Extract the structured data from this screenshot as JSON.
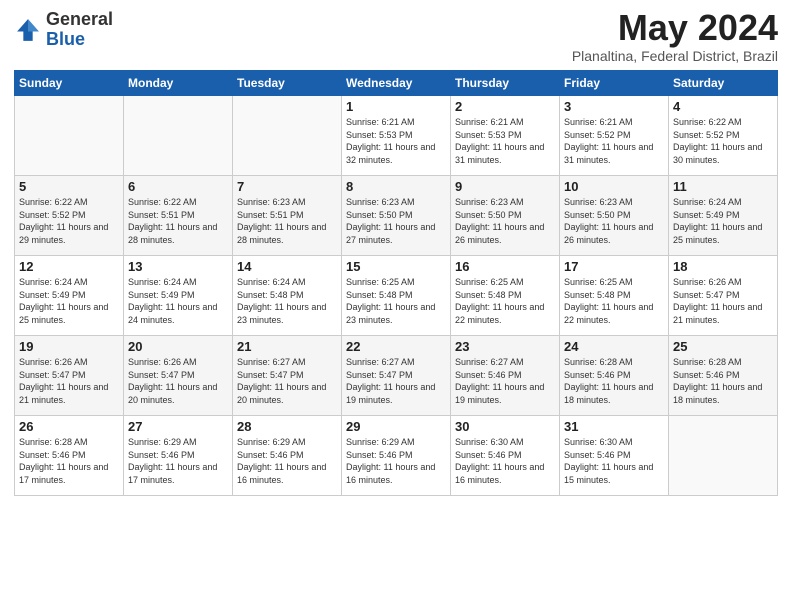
{
  "logo": {
    "general": "General",
    "blue": "Blue"
  },
  "title": "May 2024",
  "location": "Planaltina, Federal District, Brazil",
  "days_of_week": [
    "Sunday",
    "Monday",
    "Tuesday",
    "Wednesday",
    "Thursday",
    "Friday",
    "Saturday"
  ],
  "weeks": [
    [
      {
        "day": "",
        "content": ""
      },
      {
        "day": "",
        "content": ""
      },
      {
        "day": "",
        "content": ""
      },
      {
        "day": "1",
        "content": "Sunrise: 6:21 AM\nSunset: 5:53 PM\nDaylight: 11 hours and 32 minutes."
      },
      {
        "day": "2",
        "content": "Sunrise: 6:21 AM\nSunset: 5:53 PM\nDaylight: 11 hours and 31 minutes."
      },
      {
        "day": "3",
        "content": "Sunrise: 6:21 AM\nSunset: 5:52 PM\nDaylight: 11 hours and 31 minutes."
      },
      {
        "day": "4",
        "content": "Sunrise: 6:22 AM\nSunset: 5:52 PM\nDaylight: 11 hours and 30 minutes."
      }
    ],
    [
      {
        "day": "5",
        "content": "Sunrise: 6:22 AM\nSunset: 5:52 PM\nDaylight: 11 hours and 29 minutes."
      },
      {
        "day": "6",
        "content": "Sunrise: 6:22 AM\nSunset: 5:51 PM\nDaylight: 11 hours and 28 minutes."
      },
      {
        "day": "7",
        "content": "Sunrise: 6:23 AM\nSunset: 5:51 PM\nDaylight: 11 hours and 28 minutes."
      },
      {
        "day": "8",
        "content": "Sunrise: 6:23 AM\nSunset: 5:50 PM\nDaylight: 11 hours and 27 minutes."
      },
      {
        "day": "9",
        "content": "Sunrise: 6:23 AM\nSunset: 5:50 PM\nDaylight: 11 hours and 26 minutes."
      },
      {
        "day": "10",
        "content": "Sunrise: 6:23 AM\nSunset: 5:50 PM\nDaylight: 11 hours and 26 minutes."
      },
      {
        "day": "11",
        "content": "Sunrise: 6:24 AM\nSunset: 5:49 PM\nDaylight: 11 hours and 25 minutes."
      }
    ],
    [
      {
        "day": "12",
        "content": "Sunrise: 6:24 AM\nSunset: 5:49 PM\nDaylight: 11 hours and 25 minutes."
      },
      {
        "day": "13",
        "content": "Sunrise: 6:24 AM\nSunset: 5:49 PM\nDaylight: 11 hours and 24 minutes."
      },
      {
        "day": "14",
        "content": "Sunrise: 6:24 AM\nSunset: 5:48 PM\nDaylight: 11 hours and 23 minutes."
      },
      {
        "day": "15",
        "content": "Sunrise: 6:25 AM\nSunset: 5:48 PM\nDaylight: 11 hours and 23 minutes."
      },
      {
        "day": "16",
        "content": "Sunrise: 6:25 AM\nSunset: 5:48 PM\nDaylight: 11 hours and 22 minutes."
      },
      {
        "day": "17",
        "content": "Sunrise: 6:25 AM\nSunset: 5:48 PM\nDaylight: 11 hours and 22 minutes."
      },
      {
        "day": "18",
        "content": "Sunrise: 6:26 AM\nSunset: 5:47 PM\nDaylight: 11 hours and 21 minutes."
      }
    ],
    [
      {
        "day": "19",
        "content": "Sunrise: 6:26 AM\nSunset: 5:47 PM\nDaylight: 11 hours and 21 minutes."
      },
      {
        "day": "20",
        "content": "Sunrise: 6:26 AM\nSunset: 5:47 PM\nDaylight: 11 hours and 20 minutes."
      },
      {
        "day": "21",
        "content": "Sunrise: 6:27 AM\nSunset: 5:47 PM\nDaylight: 11 hours and 20 minutes."
      },
      {
        "day": "22",
        "content": "Sunrise: 6:27 AM\nSunset: 5:47 PM\nDaylight: 11 hours and 19 minutes."
      },
      {
        "day": "23",
        "content": "Sunrise: 6:27 AM\nSunset: 5:46 PM\nDaylight: 11 hours and 19 minutes."
      },
      {
        "day": "24",
        "content": "Sunrise: 6:28 AM\nSunset: 5:46 PM\nDaylight: 11 hours and 18 minutes."
      },
      {
        "day": "25",
        "content": "Sunrise: 6:28 AM\nSunset: 5:46 PM\nDaylight: 11 hours and 18 minutes."
      }
    ],
    [
      {
        "day": "26",
        "content": "Sunrise: 6:28 AM\nSunset: 5:46 PM\nDaylight: 11 hours and 17 minutes."
      },
      {
        "day": "27",
        "content": "Sunrise: 6:29 AM\nSunset: 5:46 PM\nDaylight: 11 hours and 17 minutes."
      },
      {
        "day": "28",
        "content": "Sunrise: 6:29 AM\nSunset: 5:46 PM\nDaylight: 11 hours and 16 minutes."
      },
      {
        "day": "29",
        "content": "Sunrise: 6:29 AM\nSunset: 5:46 PM\nDaylight: 11 hours and 16 minutes."
      },
      {
        "day": "30",
        "content": "Sunrise: 6:30 AM\nSunset: 5:46 PM\nDaylight: 11 hours and 16 minutes."
      },
      {
        "day": "31",
        "content": "Sunrise: 6:30 AM\nSunset: 5:46 PM\nDaylight: 11 hours and 15 minutes."
      },
      {
        "day": "",
        "content": ""
      }
    ]
  ]
}
